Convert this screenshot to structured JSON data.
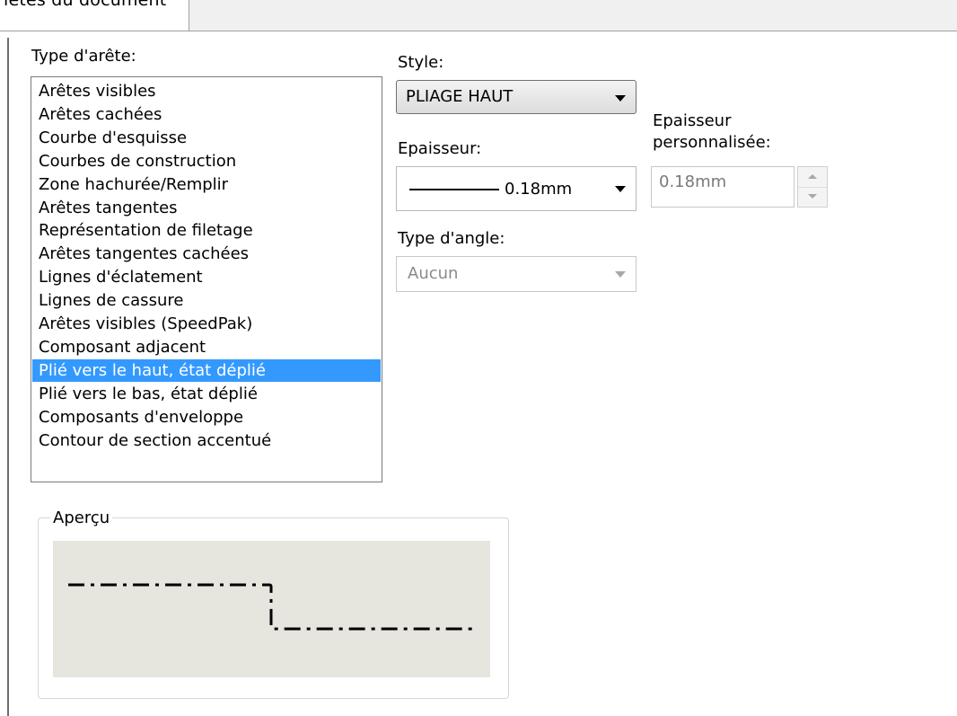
{
  "tab": {
    "label": "iétés du document"
  },
  "edge_type": {
    "label": "Type d'arête:",
    "items": [
      "Arêtes visibles",
      "Arêtes cachées",
      "Courbe d'esquisse",
      "Courbes de construction",
      "Zone hachurée/Remplir",
      "Arêtes tangentes",
      "Représentation de filetage",
      "Arêtes tangentes cachées",
      "Lignes d'éclatement",
      "Lignes de cassure",
      "Arêtes visibles (SpeedPak)",
      "Composant adjacent",
      "Plié vers le haut, état déplié",
      "Plié vers le bas, état déplié",
      "Composants d'enveloppe",
      "Contour de section accentué"
    ],
    "selected": "Plié vers le haut, état déplié"
  },
  "style": {
    "label": "Style:",
    "value": "PLIAGE HAUT"
  },
  "thickness": {
    "label": "Epaisseur:",
    "value": "0.18mm"
  },
  "custom_thickness": {
    "label_line1": "Epaisseur",
    "label_line2": "personnalisée:",
    "value": "0.18mm"
  },
  "angle_type": {
    "label": "Type d'angle:",
    "value": "Aucun"
  },
  "preview": {
    "title": "Aperçu"
  },
  "colors": {
    "selection": "#3399ff",
    "preview_background": "#e6e5de"
  }
}
